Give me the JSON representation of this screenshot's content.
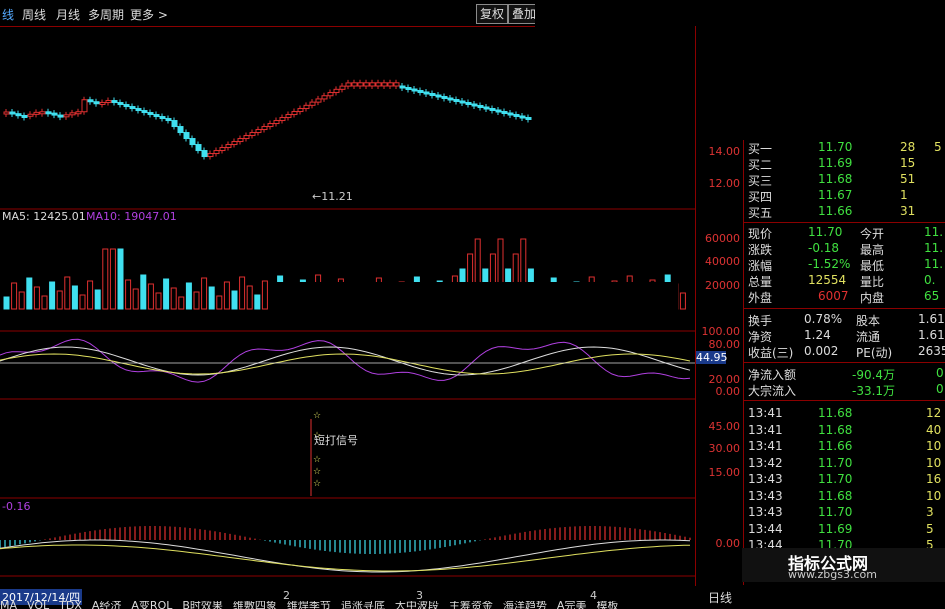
{
  "toolbar": {
    "tab_partial": "线",
    "weekly": "周线",
    "monthly": "月线",
    "multi": "多周期",
    "more": "更多 >",
    "restore": "复权",
    "overlay": "叠加"
  },
  "price_axis": {
    "t14": "14.00",
    "t12": "12.00",
    "low_label": "11.21"
  },
  "ma_legend": {
    "ma5": "MA5: 12425.01",
    "ma10": "MA10: 19047.01"
  },
  "vol_axis": {
    "t60000": "60000",
    "t40000": "40000",
    "t20000": "20000"
  },
  "osc_axis": {
    "t100": "100.00",
    "t80": "80.00",
    "cur": "44.95",
    "t20": "20.00",
    "t0": "0.00"
  },
  "signal_axis": {
    "t45": "45.00",
    "t30": "30.00",
    "t15": "15.00"
  },
  "signal_label": "短打信号",
  "macd_value": "-0.16",
  "macd_axis": {
    "t0": "0.00"
  },
  "date_label": "2017/12/14/四",
  "x_ticks": [
    "2",
    "3",
    "4"
  ],
  "bottom_tabs": [
    "MA",
    "VOL",
    "TDX",
    "A经济",
    "A变ROL",
    "B时效果",
    "维敷四象",
    "维焊季节",
    "追涨寻底",
    "大中波段",
    "主筹资金",
    "海洋趋势",
    "A完美",
    "模板"
  ],
  "daily_label": "日线",
  "order_book": [
    {
      "label": "买一",
      "price": "11.70",
      "vol": "28",
      "extra": "5"
    },
    {
      "label": "买二",
      "price": "11.69",
      "vol": "15",
      "extra": ""
    },
    {
      "label": "买三",
      "price": "11.68",
      "vol": "51",
      "extra": ""
    },
    {
      "label": "买四",
      "price": "11.67",
      "vol": "1",
      "extra": ""
    },
    {
      "label": "买五",
      "price": "11.66",
      "vol": "31",
      "extra": ""
    }
  ],
  "quote": [
    {
      "l1": "现价",
      "v1": "11.70",
      "l2": "今开",
      "v2": "11."
    },
    {
      "l1": "涨跌",
      "v1": "-0.18",
      "l2": "最高",
      "v2": "11."
    },
    {
      "l1": "涨幅",
      "v1": "-1.52%",
      "l2": "最低",
      "v2": "11."
    },
    {
      "l1": "总量",
      "v1": "12554",
      "l2": "量比",
      "v2": "0."
    },
    {
      "l1": "外盘",
      "v1": "6007",
      "l2": "内盘",
      "v2": "65"
    }
  ],
  "fundamentals": [
    {
      "l1": "换手",
      "v1": "0.78%",
      "l2": "股本",
      "v2": "1.61"
    },
    {
      "l1": "净资",
      "v1": "1.24",
      "l2": "流通",
      "v2": "1.61"
    },
    {
      "l1": "收益(三)",
      "v1": "0.002",
      "l2": "PE(动)",
      "v2": "2635"
    }
  ],
  "flows": [
    {
      "label": "净流入额",
      "value": "-90.4万",
      "extra": "0"
    },
    {
      "label": "大宗流入",
      "value": "-33.1万",
      "extra": "0"
    }
  ],
  "ticks": [
    {
      "time": "13:41",
      "price": "11.68",
      "vol": "12"
    },
    {
      "time": "13:41",
      "price": "11.68",
      "vol": "40"
    },
    {
      "time": "13:41",
      "price": "11.66",
      "vol": "10"
    },
    {
      "time": "13:42",
      "price": "11.70",
      "vol": "10"
    },
    {
      "time": "13:43",
      "price": "11.70",
      "vol": "16"
    },
    {
      "time": "13:43",
      "price": "11.68",
      "vol": "10"
    },
    {
      "time": "13:43",
      "price": "11.70",
      "vol": "3"
    },
    {
      "time": "13:44",
      "price": "11.69",
      "vol": "5"
    },
    {
      "time": "13:44",
      "price": "11.70",
      "vol": "5"
    }
  ],
  "watermark": {
    "cn": "指标公式网",
    "url": "www.zbgs3.com"
  },
  "colors": {
    "up": "#e03030",
    "down": "#40e0f0",
    "panel_border": "#8b0000",
    "magenta": "#b040e0"
  }
}
